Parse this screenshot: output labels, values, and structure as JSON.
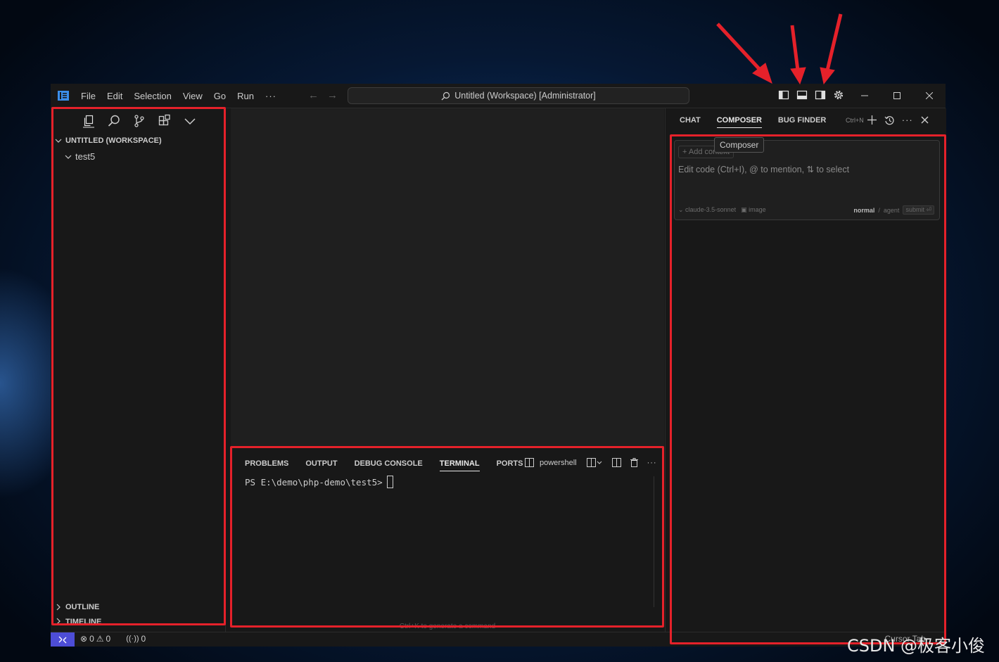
{
  "menu": [
    "File",
    "Edit",
    "Selection",
    "View",
    "Go",
    "Run",
    "···"
  ],
  "search": {
    "text": "Untitled (Workspace) [Administrator]"
  },
  "explorer": {
    "workspace_title": "UNTITLED (WORKSPACE)",
    "folder": "test5",
    "outline": "OUTLINE",
    "timeline": "TIMELINE"
  },
  "panel": {
    "tabs": [
      "PROBLEMS",
      "OUTPUT",
      "DEBUG CONSOLE",
      "TERMINAL",
      "PORTS"
    ],
    "active_tab": "TERMINAL",
    "shell": "powershell",
    "prompt": "PS E:\\demo\\php-demo\\test5>",
    "hint": "Ctrl+K to generate a command"
  },
  "aux": {
    "tabs": [
      "CHAT",
      "COMPOSER",
      "BUG FINDER"
    ],
    "active_tab": "COMPOSER",
    "shortcut": "Ctrl+N",
    "tooltip": "Composer",
    "add_context": "+ Add context",
    "placeholder": "Edit code (Ctrl+I), @ to mention, ⇅ to select",
    "model": "claude-3.5-sonnet",
    "image": "image",
    "mode_normal": "normal",
    "mode_sep": "/",
    "mode_agent": "agent",
    "submit": "submit ⏎"
  },
  "status": {
    "errors": "0",
    "warnings": "0",
    "ports": "0",
    "cursor_tab": "Cursor Tab"
  },
  "watermark": "CSDN @极客小俊",
  "colors": {
    "highlight": "#e5212a",
    "remote": "#4d4dd6",
    "background": "#181818"
  }
}
